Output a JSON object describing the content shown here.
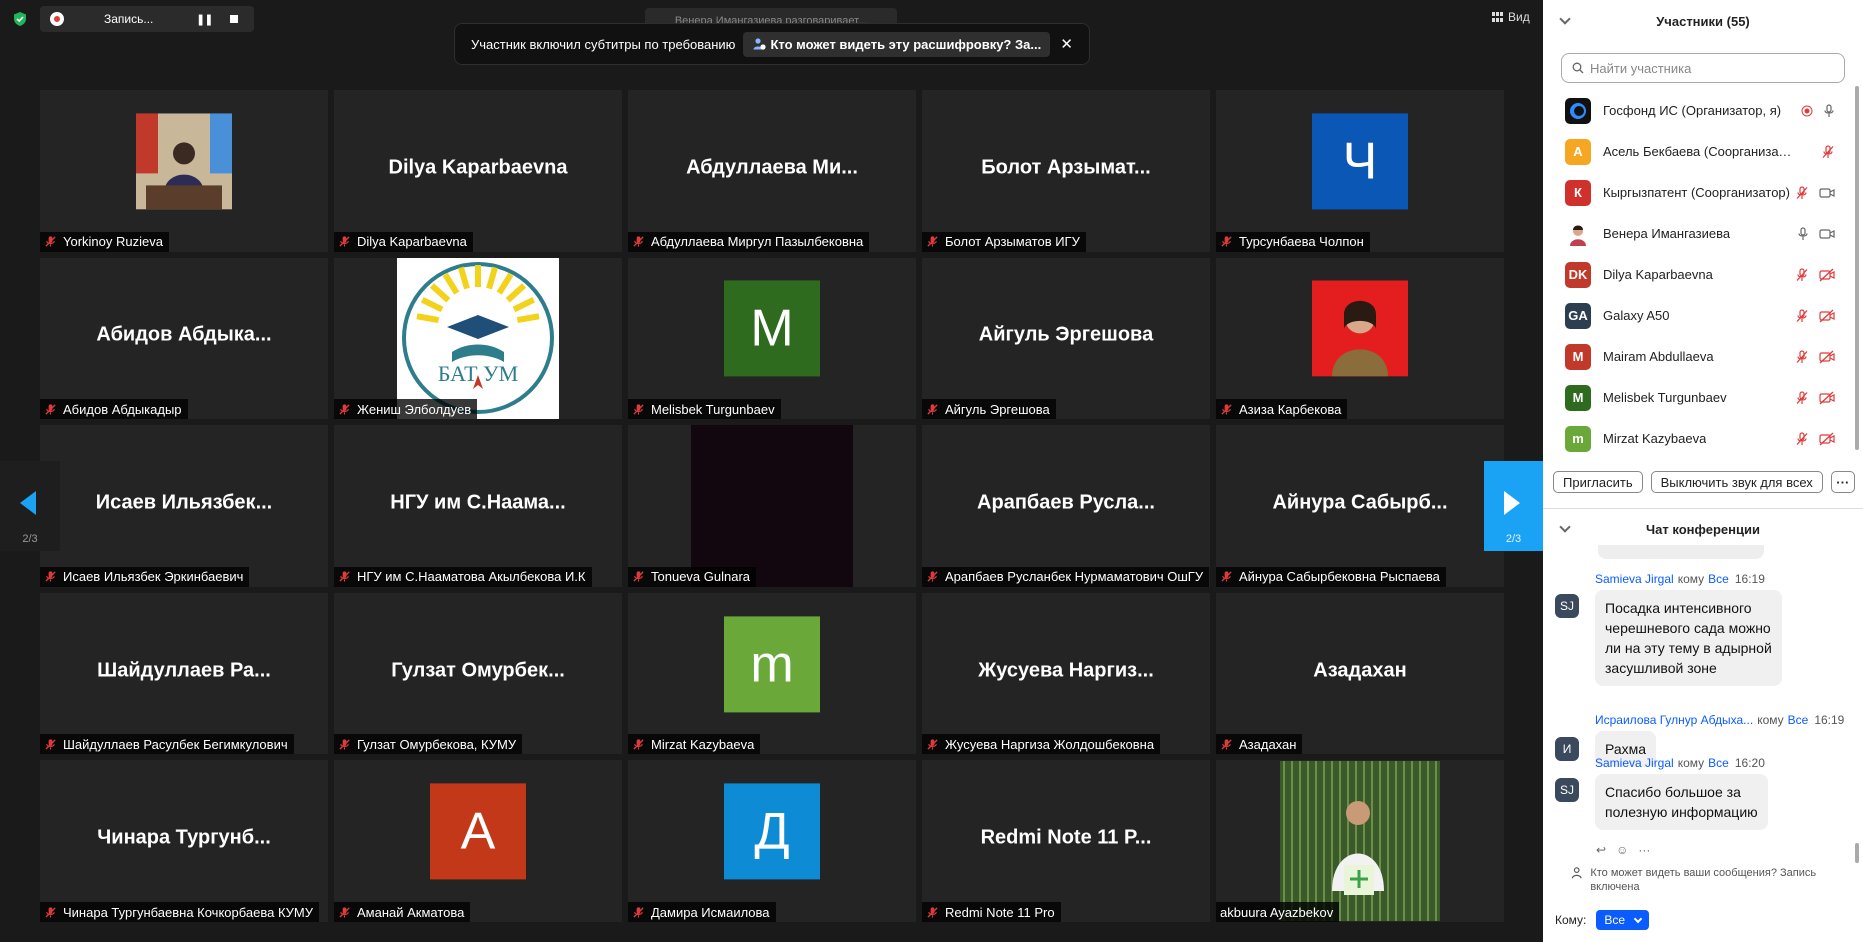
{
  "recording": {
    "label": "Запись..."
  },
  "speaker_label": "Венера Имангазиева разговаривает...",
  "caption_toast": {
    "text": "Участник включил субтитры по требованию",
    "link": "Кто может видеть эту расшифровку? За..."
  },
  "view_label": "Вид",
  "pagination": {
    "left": "2/3",
    "right": "2/3"
  },
  "tiles": [
    {
      "kind": "photo",
      "label": "Yorkinoy Ruzieva"
    },
    {
      "kind": "name",
      "name": "Dilya Kaparbaevna",
      "label": "Dilya Kaparbaevna"
    },
    {
      "kind": "name",
      "name": "Абдуллаева Ми...",
      "label": "Абдуллаева Миргул Пазылбековна"
    },
    {
      "kind": "name",
      "name": "Болот Арзымат...",
      "label": "Болот Арзыматов ИГУ"
    },
    {
      "kind": "avatar",
      "letter": "Ч",
      "color": "#0b57b5",
      "label": "Турсунбаева Чолпон"
    },
    {
      "kind": "name",
      "name": "Абидов Абдыка...",
      "label": "Абидов Абдыкадыр"
    },
    {
      "kind": "logo",
      "logo_text": "БАТ УМ",
      "label": "Жениш Элболдуев"
    },
    {
      "kind": "avatar",
      "letter": "M",
      "color": "#2f6b1f",
      "label": "Melisbek Turgunbaev"
    },
    {
      "kind": "name",
      "name": "Айгуль Эргешова",
      "label": "Айгуль Эргешова"
    },
    {
      "kind": "photo2",
      "label": "Азиза Карбекова"
    },
    {
      "kind": "name",
      "name": "Исаев Ильязбек...",
      "label": "Исаев Ильязбек Эркинбаевич"
    },
    {
      "kind": "name",
      "name": "НГУ им С.Наама...",
      "label": "НГУ им С.Нааматова Акылбекова И.К"
    },
    {
      "kind": "dark",
      "label": "Tonueva Gulnara"
    },
    {
      "kind": "name",
      "name": "Арапбаев Русла...",
      "label": "Арапбаев Русланбек Нурмаматович ОшГУ"
    },
    {
      "kind": "name",
      "name": "Айнура Сабырб...",
      "label": "Айнура Сабырбековна Рыспаева"
    },
    {
      "kind": "name",
      "name": "Шайдуллаев Ра...",
      "label": "Шайдуллаев Расулбек Бегимкулович"
    },
    {
      "kind": "name",
      "name": "Гулзат Омурбек...",
      "label": "Гулзат Омурбекова, КУМУ"
    },
    {
      "kind": "avatar",
      "letter": "m",
      "color": "#6aa83a",
      "label": "Mirzat Kazybaeva"
    },
    {
      "kind": "name",
      "name": "Жусуева Наргиз...",
      "label": "Жусуева Наргиза Жолдошбековна"
    },
    {
      "kind": "name",
      "name": "Азадахан",
      "label": "Азадахан"
    },
    {
      "kind": "name",
      "name": "Чинара Тургунб...",
      "label": "Чинара Тургунбаевна Кочкорбаева КУМУ"
    },
    {
      "kind": "avatar",
      "letter": "А",
      "color": "#c4381a",
      "label": "Аманай Акматова"
    },
    {
      "kind": "avatar",
      "letter": "Д",
      "color": "#0d8bd4",
      "label": "Дамира Исмаилова"
    },
    {
      "kind": "name",
      "name": "Redmi Note 11 P...",
      "label": "Redmi Note 11 Pro"
    },
    {
      "kind": "photo3",
      "label": "akbuura Ayazbekov",
      "nomute": true
    }
  ],
  "participants_panel": {
    "title": "Участники (55)",
    "search_placeholder": "Найти участника",
    "participants": [
      {
        "initials": "",
        "color": "#1a1a1a",
        "name": "Госфонд ИС (Организатор, я)",
        "mic": "on-rec",
        "cam": "none"
      },
      {
        "initials": "А",
        "color": "#f5a623",
        "name": "Асель Бекбаева (Соорганизатор)",
        "mic": "muted",
        "cam": "none"
      },
      {
        "initials": "К",
        "color": "#d0312d",
        "name": "Кыргызпатент (Соорганизатор)",
        "mic": "muted",
        "cam": "on"
      },
      {
        "initials": "",
        "color": "#c98",
        "name": "Венера Имангазиева",
        "mic": "on",
        "cam": "on"
      },
      {
        "initials": "DK",
        "color": "#c0392b",
        "name": "Dilya Kaparbaevna",
        "mic": "muted",
        "cam": "off"
      },
      {
        "initials": "GA",
        "color": "#2c3e50",
        "name": "Galaxy A50",
        "mic": "muted",
        "cam": "off"
      },
      {
        "initials": "M",
        "color": "#c0392b",
        "name": "Mairam Abdullaeva",
        "mic": "muted",
        "cam": "off"
      },
      {
        "initials": "M",
        "color": "#2f6b1f",
        "name": "Melisbek Turgunbaev",
        "mic": "muted",
        "cam": "off"
      },
      {
        "initials": "m",
        "color": "#6aa83a",
        "name": "Mirzat Kazybaeva",
        "mic": "muted",
        "cam": "off"
      }
    ],
    "invite_label": "Пригласить",
    "mute_all_label": "Выключить звук для всех",
    "more_label": "···"
  },
  "chat_panel": {
    "title": "Чат конференции",
    "messages": [
      {
        "initials": "SJ",
        "sender": "Samieva Jirgal",
        "to": "кому",
        "target": "Все",
        "time": "16:19",
        "lines": [
          "Посадка интенсивного",
          "черешневого сада можно",
          "ли на эту тему в адырной",
          "засушливой зоне"
        ]
      },
      {
        "initials": "И",
        "sender": "Исраилова Гулнур Абдыха...",
        "to": "кому",
        "target": "Все",
        "time": "16:19",
        "lines": [
          "Рахма"
        ]
      },
      {
        "initials": "SJ",
        "sender": "Samieva Jirgal",
        "to": "кому",
        "target": "Все",
        "time": "16:20",
        "lines": [
          "Спасибо большое за",
          "полезную информацию"
        ]
      }
    ],
    "notice": "Кто может видеть ваши сообщения? Запись включена",
    "to_label": "Кому:",
    "to_value": "Все"
  }
}
